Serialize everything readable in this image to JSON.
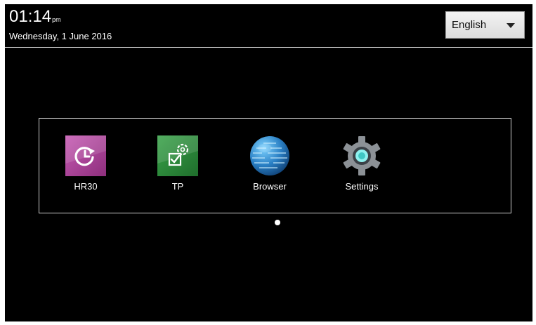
{
  "status_bar": {
    "time": "01:14",
    "ampm": "pm",
    "date": "Wednesday, 1 June 2016"
  },
  "language_select": {
    "selected": "English",
    "icon": "chevron-down-icon"
  },
  "apps": [
    {
      "label": "HR30",
      "icon": "hr30-icon",
      "color": "#b0479b"
    },
    {
      "label": "TP",
      "icon": "tp-icon",
      "color": "#2f8f3e"
    },
    {
      "label": "Browser",
      "icon": "globe-icon",
      "color": "#2a7fc4"
    },
    {
      "label": "Settings",
      "icon": "gear-icon",
      "color": "#8c9196"
    }
  ],
  "pager": {
    "page_count": 1,
    "current_page": 1
  },
  "colors": {
    "background": "#000000",
    "text": "#ffffff",
    "divider": "#cfcfcf"
  }
}
